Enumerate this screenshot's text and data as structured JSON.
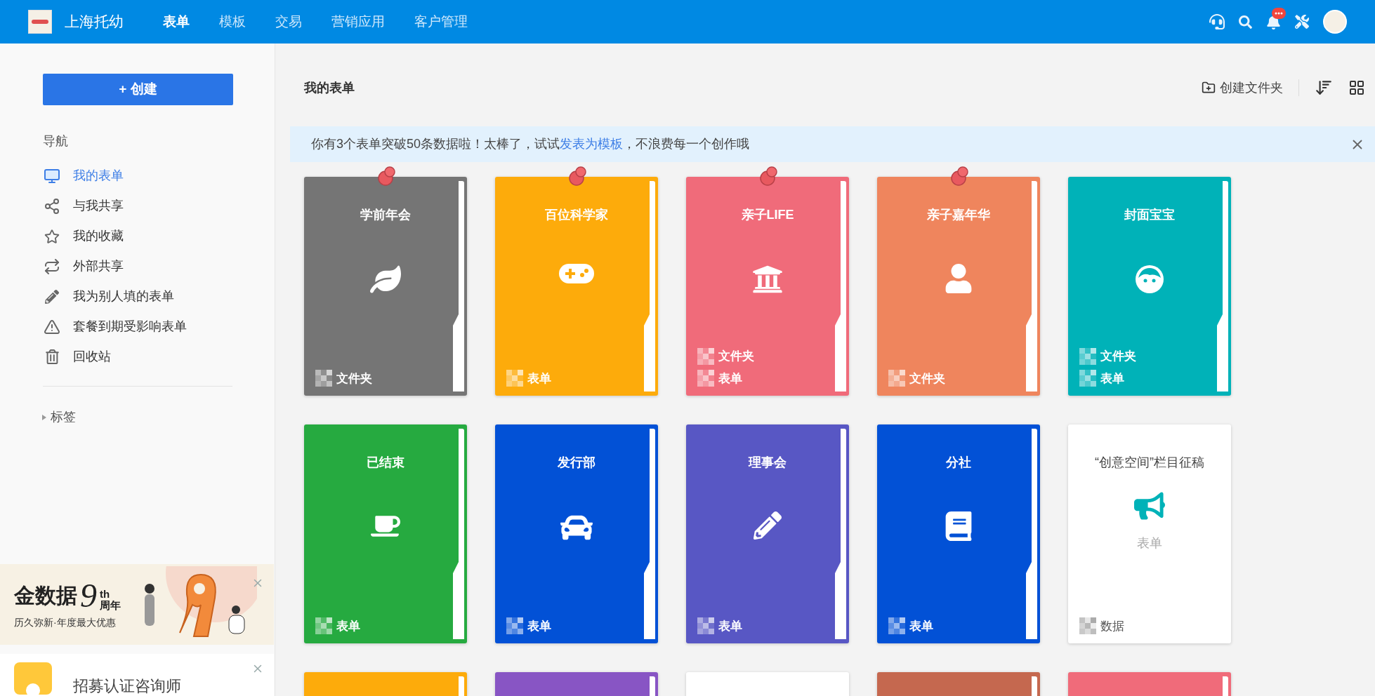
{
  "topbar": {
    "brand": "上海托幼",
    "tabs": [
      {
        "label": "表单",
        "selected": true
      },
      {
        "label": "模板",
        "selected": false
      },
      {
        "label": "交易",
        "selected": false
      },
      {
        "label": "营销应用",
        "selected": false
      },
      {
        "label": "客户管理",
        "selected": false
      }
    ]
  },
  "sidebar": {
    "create_button": "+ 创建",
    "nav_title": "导航",
    "items": [
      {
        "label": "我的表单",
        "selected": true
      },
      {
        "label": "与我共享",
        "selected": false
      },
      {
        "label": "我的收藏",
        "selected": false
      },
      {
        "label": "外部共享",
        "selected": false
      },
      {
        "label": "我为别人填的表单",
        "selected": false
      },
      {
        "label": "套餐到期受影响表单",
        "selected": false
      },
      {
        "label": "回收站",
        "selected": false
      }
    ],
    "tags": {
      "label": "标签",
      "expanded": false
    },
    "promo": {
      "brand": "金数据",
      "numeral": "9",
      "suffix": "th",
      "anniversary": "周年",
      "tagline": "历久弥新·年度最大优惠"
    },
    "recruit": {
      "title": "招募认证咨询师"
    }
  },
  "main": {
    "title": "我的表单",
    "create_folder": "创建文件夹",
    "notice": {
      "before": "你有3个表单突破50条数据啦！太棒了，试试",
      "link": "发表为模板",
      "after": "，不浪费每一个创作哦"
    },
    "cards": [
      {
        "kind": "folder",
        "title": "学前年会",
        "color": "#757575",
        "pinned": true,
        "footer": [
          {
            "label": "文件夹"
          }
        ]
      },
      {
        "kind": "folder",
        "title": "百位科学家",
        "color": "#fdab0b",
        "pinned": true,
        "footer": [
          {
            "label": "表单"
          }
        ]
      },
      {
        "kind": "folder",
        "title": "亲子LIFE",
        "color": "#f06b7a",
        "pinned": true,
        "footer": [
          {
            "label": "文件夹"
          },
          {
            "label": "表单"
          }
        ]
      },
      {
        "kind": "folder",
        "title": "亲子嘉年华",
        "color": "#ef855d",
        "pinned": true,
        "footer": [
          {
            "label": "文件夹"
          }
        ]
      },
      {
        "kind": "folder",
        "title": "封面宝宝",
        "color": "#00b2b8",
        "pinned": false,
        "footer": [
          {
            "label": "文件夹"
          },
          {
            "label": "表单"
          }
        ]
      },
      {
        "kind": "folder",
        "title": "已结束",
        "color": "#26aa40",
        "pinned": false,
        "footer": [
          {
            "label": "表单"
          }
        ]
      },
      {
        "kind": "folder",
        "title": "发行部",
        "color": "#0251d6",
        "pinned": false,
        "footer": [
          {
            "label": "表单"
          }
        ]
      },
      {
        "kind": "folder",
        "title": "理事会",
        "color": "#5857c4",
        "pinned": false,
        "footer": [
          {
            "label": "表单"
          }
        ]
      },
      {
        "kind": "folder",
        "title": "分社",
        "color": "#0251d6",
        "pinned": false,
        "footer": [
          {
            "label": "表单"
          }
        ]
      },
      {
        "kind": "plain",
        "title": "“创意空间”栏目征稿",
        "color": "#ffffff",
        "pinned": false,
        "subtitle": "表单",
        "footer": [
          {
            "label": "数据"
          }
        ]
      },
      {
        "kind": "folder",
        "color": "#fdab0b"
      },
      {
        "kind": "folder",
        "color": "#8855c4"
      },
      {
        "kind": "plain",
        "color": "#ffffff"
      },
      {
        "kind": "folder",
        "color": "#c5684f"
      },
      {
        "kind": "folder",
        "color": "#f06b7a"
      }
    ]
  }
}
